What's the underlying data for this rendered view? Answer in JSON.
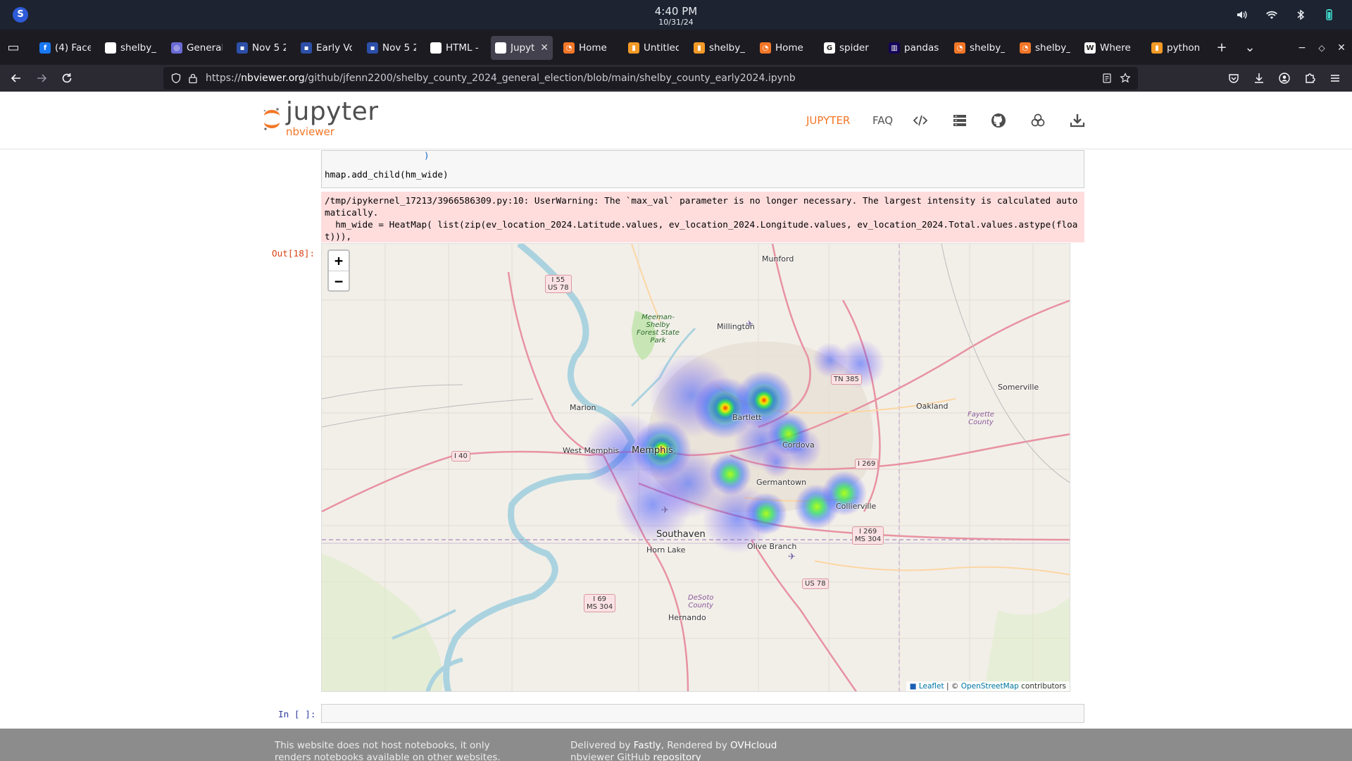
{
  "os": {
    "time": "4:40 PM",
    "date": "10/31/24",
    "logo_letter": "S",
    "tray_icons": [
      "volume-icon",
      "wifi-icon",
      "bluetooth-icon",
      "battery-icon"
    ]
  },
  "tabs": [
    {
      "label": "(4) Face",
      "fav": "facebook",
      "active": false
    },
    {
      "label": "shelby_",
      "fav": "github",
      "active": false
    },
    {
      "label": "General",
      "fav": "globe",
      "active": false
    },
    {
      "label": "Nov 5 2",
      "fav": "news",
      "active": false
    },
    {
      "label": "Early Vo",
      "fav": "news",
      "active": false
    },
    {
      "label": "Nov 5 2",
      "fav": "news",
      "active": false
    },
    {
      "label": "HTML -",
      "fav": "github",
      "active": false
    },
    {
      "label": "Jupyt",
      "fav": "jupyter",
      "active": true
    },
    {
      "label": "Home",
      "fav": "orange",
      "active": false
    },
    {
      "label": "Untitled",
      "fav": "orange-doc",
      "active": false
    },
    {
      "label": "shelby_",
      "fav": "orange-doc",
      "active": false
    },
    {
      "label": "Home",
      "fav": "orange",
      "active": false
    },
    {
      "label": "spider",
      "fav": "google",
      "active": false
    },
    {
      "label": "pandas",
      "fav": "pandas",
      "active": false
    },
    {
      "label": "shelby_",
      "fav": "orange",
      "active": false
    },
    {
      "label": "shelby_",
      "fav": "orange",
      "active": false
    },
    {
      "label": "Where",
      "fav": "wiki",
      "active": false
    },
    {
      "label": "python",
      "fav": "orange-doc",
      "active": false
    }
  ],
  "browser": {
    "url_prefix": "https://",
    "url_domain": "nbviewer.org",
    "url_path": "/github/jfenn2200/shelby_county_2024_general_election/blob/main/shelby_county_early2024.ipynb",
    "new_tab": "+",
    "tab_list": "⌄"
  },
  "header": {
    "logo_word": "jupyter",
    "logo_sub": "nbviewer",
    "jupyter_link": "JUPYTER",
    "faq_link": "FAQ",
    "icons": [
      "code-icon",
      "server-icon",
      "github-icon",
      "notebook-icon",
      "download-icon"
    ]
  },
  "notebook": {
    "code_tail": ")",
    "code_line": "hmap.add_child(hm_wide)",
    "stderr": "/tmp/ipykernel_17213/3966586309.py:10: UserWarning: The `max_val` parameter is no longer necessary. The largest intensity is calculated automatically.\n  hm_wide = HeatMap( list(zip(ev_location_2024.Latitude.values, ev_location_2024.Longitude.values, ev_location_2024.Total.values.astype(float))),",
    "out_prompt": "Out[18]:",
    "in_prompt": "In [ ]:"
  },
  "map": {
    "zoom_in": "+",
    "zoom_out": "−",
    "cities": [
      "Munford",
      "Millington",
      "Marion",
      "West Memphis",
      "Memphis",
      "Bartlett",
      "Cordova",
      "Germantown",
      "Collierville",
      "Oakland",
      "Somerville",
      "Southaven",
      "Horn Lake",
      "Olive Branch",
      "Hernando"
    ],
    "shields": [
      "I 55\nUS 78",
      "TN 385",
      "I 40",
      "I 269",
      "I 269\nMS 304",
      "US 78",
      "I 69\nMS 304"
    ],
    "parks": [
      "Meeman-\nShelby\nForest State\nPark"
    ],
    "counties": [
      "Fayette\nCounty",
      "DeSoto\nCounty"
    ],
    "attribution_leaflet": "Leaflet",
    "attribution_sep": " | © ",
    "attribution_osm": "OpenStreetMap",
    "attribution_tail": " contributors"
  },
  "footer": {
    "left": "This website does not host notebooks, it only renders notebooks available on other websites.",
    "delivered_by": "Delivered by ",
    "fastly": "Fastly",
    "rendered_by": ", Rendered by ",
    "ovh": "OVHcloud",
    "repo_prefix": "nbviewer GitHub ",
    "repo_link": "repository"
  },
  "colors": {
    "jupyter_orange": "#f37626",
    "prompt_blue": "#303f9f",
    "prompt_red": "#d84315",
    "stderr_bg": "#ffdddd"
  }
}
